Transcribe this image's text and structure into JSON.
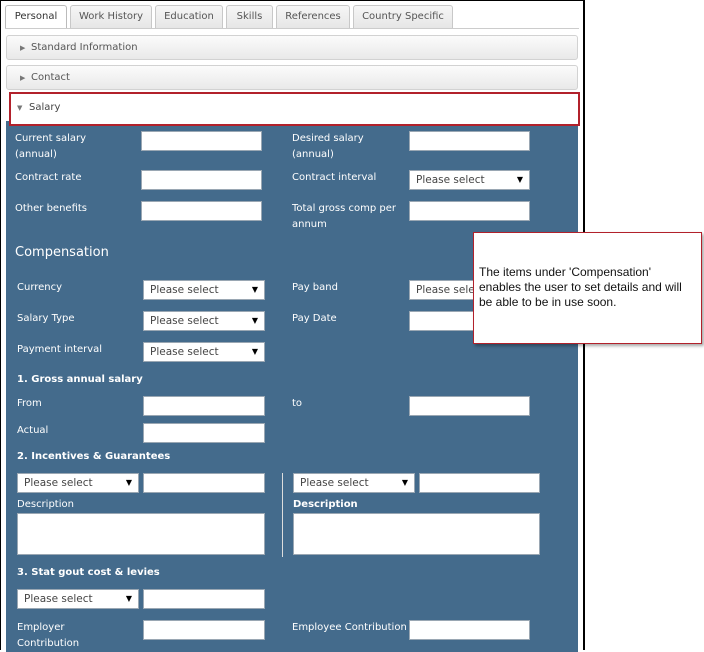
{
  "tabs": [
    "Personal",
    "Work History",
    "Education",
    "Skills",
    "References",
    "Country Specific"
  ],
  "accordion": {
    "standard": "Standard Information",
    "contact": "Contact",
    "salary": "Salary"
  },
  "salary": {
    "current_salary": "Current salary (annual)",
    "desired_salary": "Desired salary (annual)",
    "contract_rate": "Contract rate",
    "contract_interval": "Contract interval",
    "other_benefits": "Other benefits",
    "total_gross": "Total gross comp per annum"
  },
  "select_placeholder": "Please select",
  "compensation": {
    "heading": "Compensation",
    "currency": "Currency",
    "pay_band": "Pay band",
    "salary_type": "Salary Type",
    "pay_date": "Pay Date",
    "payment_interval": "Payment interval"
  },
  "gross": {
    "heading": "1. Gross annual salary",
    "from": "From",
    "to": "to",
    "actual": "Actual"
  },
  "incentives": {
    "heading": "2. Incentives & Guarantees",
    "description_left": "Description",
    "description_right": "Description"
  },
  "stat": {
    "heading": "3. Stat gout cost & levies",
    "employer": "Employer Contribution",
    "employee": "Employee Contribution"
  },
  "callout": {
    "text": "The items under 'Compensation' enables the user to set details and will be able to be in use soon."
  }
}
